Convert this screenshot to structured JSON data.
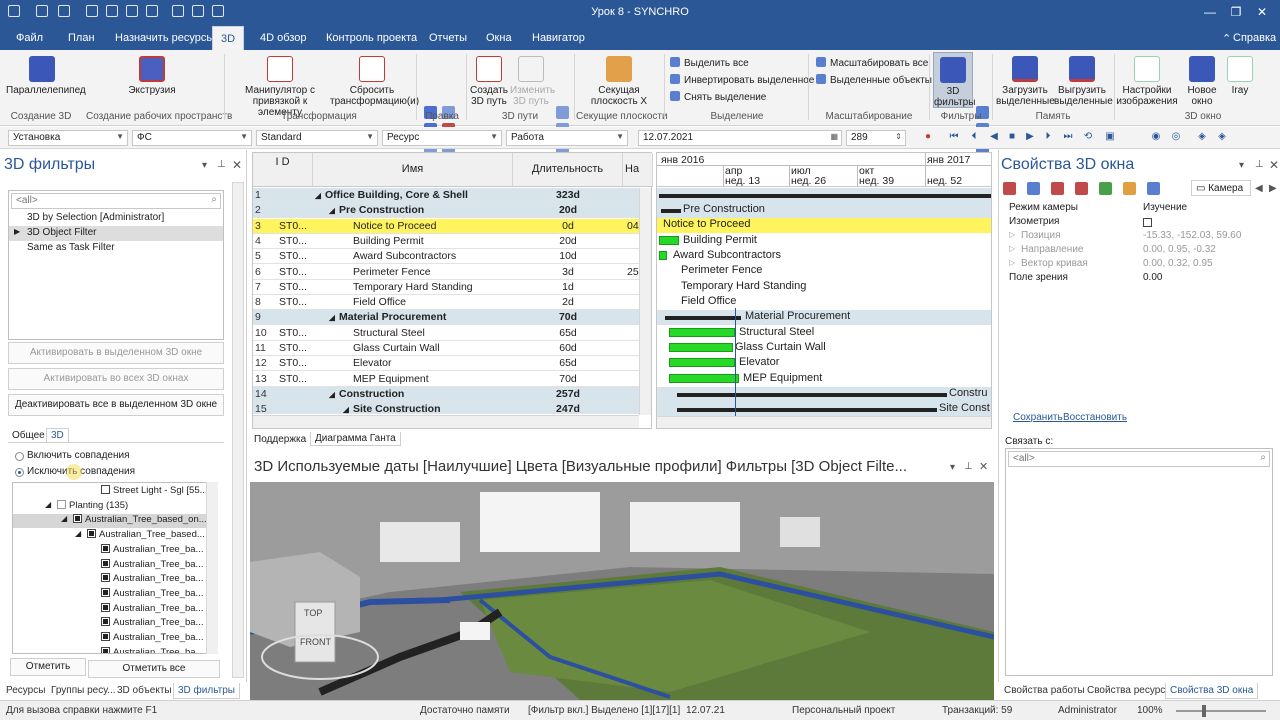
{
  "app": {
    "title": "Урок 8 - SYNCHRO"
  },
  "menu": {
    "tabs": [
      "Файл",
      "План",
      "Назначить ресурсы",
      "3D",
      "4D обзор",
      "Контроль проекта",
      "Отчеты",
      "Окна",
      "Навигатор"
    ],
    "active": "3D",
    "help": "Справка"
  },
  "ribbon": {
    "buttons": {
      "box": "Параллелепипед",
      "extrude": "Экструзия",
      "manip": "Манипулятор с привязкой к элементу",
      "reset": "Сбросить трансформацию(и)",
      "create_path": "Создать 3D путь",
      "change_path": "Изменить 3D путь",
      "section": "Секущая плоскость X",
      "select_all": "Выделить все",
      "invert": "Инвертировать выделенное",
      "deselect": "Снять выделение",
      "scale_all": "Масштабировать все",
      "selected_objects": "Выделенные объекты",
      "filters_3d": "3D фильтры",
      "load": "Загрузить выделенные",
      "unload": "Выгрузить выделенные",
      "img_settings": "Настройки изображения",
      "new_window": "Новое окно",
      "iray": "Iray"
    },
    "groups": {
      "create3d": "Создание 3D",
      "user_space": "Создание рабочих пространств",
      "transform": "Трансформация",
      "edit": "Правка",
      "paths": "3D пути",
      "sections": "Секущие плоскости",
      "selection": "Выделение",
      "scaling": "Масштабирование",
      "filters": "Фильтры",
      "memory": "Память",
      "window": "3D окно"
    }
  },
  "toolbar2": {
    "install": "Установка",
    "fs": "ФС",
    "standard": "Standard",
    "resource": "Ресурс",
    "work": "Работа",
    "date": "12.07.2021",
    "num": "289"
  },
  "left": {
    "title": "3D фильтры",
    "search_placeholder": "<all>",
    "filters": [
      "3D by Selection [Administrator]",
      "3D Object Filter",
      "Same as Task Filter"
    ],
    "selected_filter": 1,
    "btn_activate_selected": "Активировать в выделенном 3D окне",
    "btn_activate_all": "Активировать во всех 3D окнах",
    "btn_deactivate": "Деактивировать все в выделенном 3D окне",
    "tabs": [
      "Общее",
      "3D"
    ],
    "radio_include": "Включить совпадения",
    "radio_exclude": "Исключить совпадения",
    "tree": [
      {
        "label": "Street Light - Sgl [55...",
        "indent": 88,
        "chk": "empty"
      },
      {
        "label": "Planting (135)",
        "indent": 44,
        "chk": "gray"
      },
      {
        "label": "Australian_Tree_based_on...",
        "indent": 60,
        "chk": "on",
        "sel": true
      },
      {
        "label": "Australian_Tree_based...",
        "indent": 74,
        "chk": "on"
      },
      {
        "label": "Australian_Tree_ba...",
        "indent": 88,
        "chk": "on"
      },
      {
        "label": "Australian_Tree_ba...",
        "indent": 88,
        "chk": "on"
      },
      {
        "label": "Australian_Tree_ba...",
        "indent": 88,
        "chk": "on"
      },
      {
        "label": "Australian_Tree_ba...",
        "indent": 88,
        "chk": "on"
      },
      {
        "label": "Australian_Tree_ba...",
        "indent": 88,
        "chk": "on"
      },
      {
        "label": "Australian_Tree_ba...",
        "indent": 88,
        "chk": "on"
      },
      {
        "label": "Australian_Tree_ba...",
        "indent": 88,
        "chk": "on"
      },
      {
        "label": "Australian_Tree_ba...",
        "indent": 88,
        "chk": "on"
      }
    ],
    "btn_mark": "Отметить",
    "btn_mark_all": "Отметить все",
    "bottom_tabs": [
      "Ресурсы",
      "Группы ресу...",
      "3D объекты",
      "3D фильтры"
    ]
  },
  "grid": {
    "headers": {
      "id": "I D",
      "name": "Имя",
      "duration": "Длительность",
      "start": "На"
    },
    "rows": [
      {
        "n": "1",
        "id": "",
        "name": "Office Building, Core & Shell",
        "dur": "323d",
        "start": "",
        "lvl": 0,
        "type": "summary"
      },
      {
        "n": "2",
        "id": "",
        "name": "Pre Construction",
        "dur": "20d",
        "start": "",
        "lvl": 1,
        "type": "summary"
      },
      {
        "n": "3",
        "id": "ST0...",
        "name": "Notice to Proceed",
        "dur": "0d",
        "start": "04",
        "lvl": 2,
        "type": "hl"
      },
      {
        "n": "4",
        "id": "ST0...",
        "name": "Building Permit",
        "dur": "20d",
        "start": "",
        "lvl": 2,
        "type": ""
      },
      {
        "n": "5",
        "id": "ST0...",
        "name": "Award Subcontractors",
        "dur": "10d",
        "start": "",
        "lvl": 2,
        "type": ""
      },
      {
        "n": "6",
        "id": "ST0...",
        "name": "Perimeter Fence",
        "dur": "3d",
        "start": "25",
        "lvl": 2,
        "type": ""
      },
      {
        "n": "7",
        "id": "ST0...",
        "name": "Temporary Hard Standing",
        "dur": "1d",
        "start": "",
        "lvl": 2,
        "type": ""
      },
      {
        "n": "8",
        "id": "ST0...",
        "name": "Field Office",
        "dur": "2d",
        "start": "",
        "lvl": 2,
        "type": ""
      },
      {
        "n": "9",
        "id": "",
        "name": "Material Procurement",
        "dur": "70d",
        "start": "",
        "lvl": 1,
        "type": "summary"
      },
      {
        "n": "10",
        "id": "ST0...",
        "name": "Structural Steel",
        "dur": "65d",
        "start": "",
        "lvl": 2,
        "type": ""
      },
      {
        "n": "11",
        "id": "ST0...",
        "name": "Glass Curtain Wall",
        "dur": "60d",
        "start": "",
        "lvl": 2,
        "type": ""
      },
      {
        "n": "12",
        "id": "ST0...",
        "name": "Elevator",
        "dur": "65d",
        "start": "",
        "lvl": 2,
        "type": ""
      },
      {
        "n": "13",
        "id": "ST0...",
        "name": "MEP Equipment",
        "dur": "70d",
        "start": "",
        "lvl": 2,
        "type": ""
      },
      {
        "n": "14",
        "id": "",
        "name": "Construction",
        "dur": "257d",
        "start": "",
        "lvl": 1,
        "type": "summary"
      },
      {
        "n": "15",
        "id": "",
        "name": "Site Construction",
        "dur": "247d",
        "start": "",
        "lvl": 2,
        "type": "summary"
      }
    ]
  },
  "gantt": {
    "years": [
      "янв 2016",
      "янв 2017"
    ],
    "months": [
      "апр",
      "июл",
      "окт"
    ],
    "weeks": [
      "нед. 13",
      "нед. 26",
      "нед. 39",
      "нед. 52"
    ],
    "labels": [
      "Pre Construction",
      "Notice to Proceed",
      "Building Permit",
      "Award Subcontractors",
      "Perimeter Fence",
      "Temporary Hard Standing",
      "Field Office",
      "Material Procurement",
      "Structural Steel",
      "Glass Curtain Wall",
      "Elevator",
      "MEP Equipment",
      "Constru",
      "Site Const"
    ]
  },
  "panel_tabs": [
    "Поддержка",
    "Диаграмма Ганта"
  ],
  "view3d": {
    "title": "3D Используемые даты [Наилучшие] Цвета [Визуальные профили] Фильтры [3D Object Filte...",
    "cube_top": "TOP",
    "cube_front": "FRONT"
  },
  "right": {
    "title": "Свойства 3D окна",
    "camera_tab": "Камера",
    "props": [
      {
        "k": "Режим камеры",
        "v": "Изучение",
        "dim": false
      },
      {
        "k": "Изометрия",
        "v": "",
        "dim": false
      },
      {
        "k": "Позиция",
        "v": "-15.33, -152.03, 59.60",
        "dim": true
      },
      {
        "k": "Направление",
        "v": "0.00, 0.95, -0.32",
        "dim": true
      },
      {
        "k": "Вектор кривая",
        "v": "0.00, 0.32, 0.95",
        "dim": true
      },
      {
        "k": "Поле зрения",
        "v": "0.00",
        "dim": false
      }
    ],
    "save": "Сохранить",
    "restore": "Восстановить",
    "link_label": "Связать с:",
    "link_placeholder": "<all>",
    "bottom_tabs": [
      "Свойства работы",
      "Свойства ресурса",
      "Свойства 3D окна"
    ]
  },
  "status": {
    "help": "Для вызова справки нажмите F1",
    "memory": "Достаточно памяти",
    "filter": "[Фильтр вкл.] Выделено [1][17][1]",
    "date": "12.07.21",
    "project": "Персональный проект",
    "transactions": "Транзакций: 59",
    "user": "Administrator",
    "zoom": "100%"
  }
}
